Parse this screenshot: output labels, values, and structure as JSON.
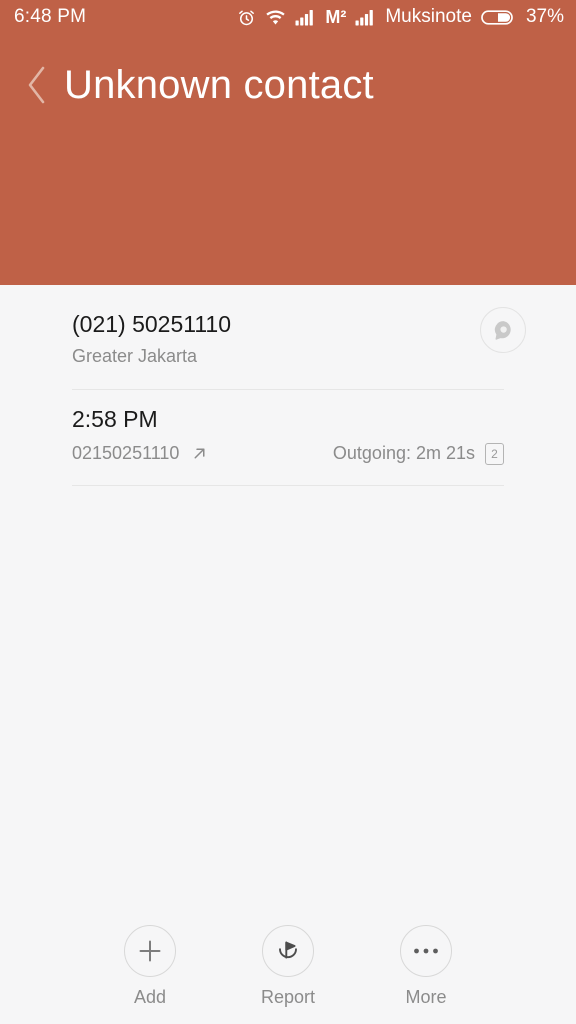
{
  "statusbar": {
    "time": "6:48 PM",
    "alarm_icon": "alarm-clock-icon",
    "wifi_icon": "wifi-icon",
    "signal1_icon": "signal-bars-icon",
    "network_label": "M²",
    "signal2_icon": "signal-bars-icon",
    "carrier": "Muksinote",
    "battery_icon": "battery-icon",
    "battery_percent": "37%"
  },
  "header": {
    "back_icon": "chevron-left-icon",
    "title": "Unknown contact",
    "background_color": "#bf6147",
    "title_color": "#ffffff"
  },
  "contact": {
    "number": "(021) 50251110",
    "location": "Greater Jakarta",
    "message_icon": "message-bubble-icon"
  },
  "call_log": [
    {
      "time": "2:58 PM",
      "number": "02150251110",
      "direction_icon": "outgoing-arrow-icon",
      "detail": "Outgoing: 2m 21s",
      "sim": "2"
    }
  ],
  "actions": [
    {
      "label": "Add",
      "icon": "plus-icon"
    },
    {
      "label": "Report",
      "icon": "flag-report-icon"
    },
    {
      "label": "More",
      "icon": "more-dots-icon"
    }
  ],
  "colors": {
    "accent": "#bf6147",
    "body_bg": "#f6f6f7",
    "primary_text": "#1b1b1b",
    "secondary_text": "#8b8b8b",
    "divider": "#e6e6e6"
  }
}
